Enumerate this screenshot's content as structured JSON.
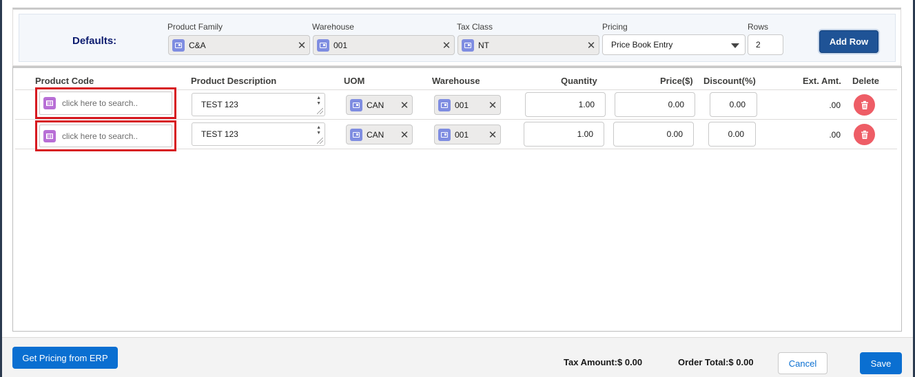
{
  "defaults": {
    "title": "Defaults:",
    "product_family": {
      "label": "Product Family",
      "value": "C&A"
    },
    "warehouse": {
      "label": "Warehouse",
      "value": "001"
    },
    "tax_class": {
      "label": "Tax Class",
      "value": "NT"
    },
    "pricing": {
      "label": "Pricing",
      "value": "Price Book Entry"
    },
    "rows": {
      "label": "Rows",
      "value": "2"
    },
    "add_row_label": "Add Row"
  },
  "columns": {
    "product_code": "Product Code",
    "product_description": "Product Description",
    "uom": "UOM",
    "warehouse": "Warehouse",
    "quantity": "Quantity",
    "price": "Price($)",
    "discount": "Discount(%)",
    "ext_amt": "Ext. Amt.",
    "delete": "Delete"
  },
  "rows": [
    {
      "search_placeholder": "click here to search..",
      "description": "TEST 123",
      "uom": "CAN",
      "warehouse": "001",
      "quantity": "1.00",
      "price": "0.00",
      "discount": "0.00",
      "ext_amt": ".00"
    },
    {
      "search_placeholder": "click here to search..",
      "description": "TEST 123",
      "uom": "CAN",
      "warehouse": "001",
      "quantity": "1.00",
      "price": "0.00",
      "discount": "0.00",
      "ext_amt": ".00"
    }
  ],
  "footer": {
    "erp_button": "Get Pricing from ERP",
    "tax_amount": "Tax Amount:$ 0.00",
    "order_total": "Order Total:$ 0.00",
    "cancel": "Cancel",
    "save": "Save"
  },
  "colors": {
    "highlight_border": "#d71920",
    "primary": "#0a6fd1",
    "add_row": "#1f5396",
    "delete": "#ee5d66"
  }
}
